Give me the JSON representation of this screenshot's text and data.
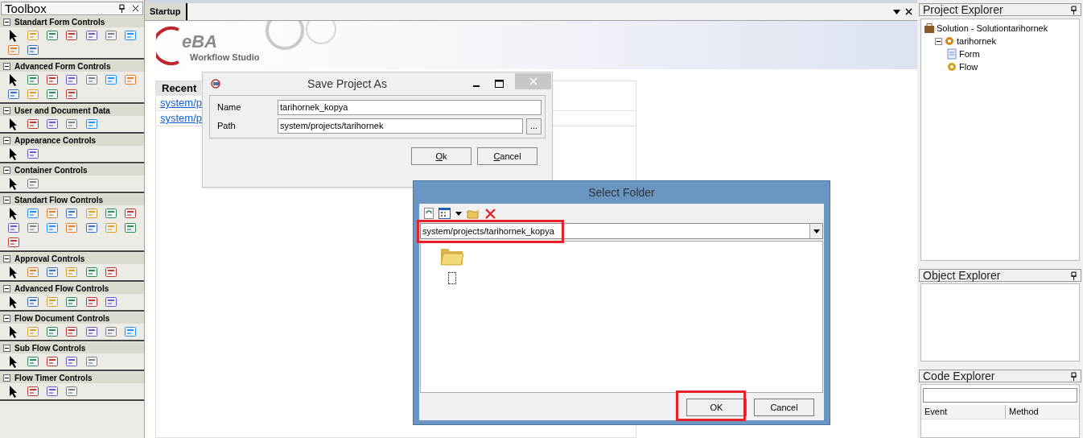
{
  "toolbox": {
    "title": "Toolbox",
    "sections": [
      {
        "title": "Standart Form Controls",
        "expanded": true,
        "tools": [
          {
            "kind": "pointer"
          },
          {
            "kind": "control"
          },
          {
            "kind": "control"
          },
          {
            "kind": "control"
          },
          {
            "kind": "control"
          },
          {
            "kind": "control"
          },
          {
            "kind": "control"
          },
          {
            "kind": "control"
          },
          {
            "kind": "control"
          }
        ]
      },
      {
        "title": "Advanced Form Controls",
        "expanded": true,
        "tools": [
          {
            "kind": "pointer"
          },
          {
            "kind": "control"
          },
          {
            "kind": "control"
          },
          {
            "kind": "control"
          },
          {
            "kind": "control"
          },
          {
            "kind": "control"
          },
          {
            "kind": "control"
          },
          {
            "kind": "control"
          },
          {
            "kind": "control"
          },
          {
            "kind": "control"
          },
          {
            "kind": "control"
          }
        ]
      },
      {
        "title": "User and Document Data",
        "expanded": true,
        "tools": [
          {
            "kind": "pointer"
          },
          {
            "kind": "control"
          },
          {
            "kind": "control"
          },
          {
            "kind": "control"
          },
          {
            "kind": "control"
          }
        ]
      },
      {
        "title": "Appearance Controls",
        "expanded": true,
        "tools": [
          {
            "kind": "pointer"
          },
          {
            "kind": "control"
          }
        ]
      },
      {
        "title": "Container Controls",
        "expanded": true,
        "tools": [
          {
            "kind": "pointer"
          },
          {
            "kind": "control"
          }
        ]
      },
      {
        "title": "Standart Flow Controls",
        "expanded": true,
        "tools": [
          {
            "kind": "pointer"
          },
          {
            "kind": "control"
          },
          {
            "kind": "control"
          },
          {
            "kind": "control"
          },
          {
            "kind": "control"
          },
          {
            "kind": "control"
          },
          {
            "kind": "control"
          },
          {
            "kind": "control"
          },
          {
            "kind": "control"
          },
          {
            "kind": "control"
          },
          {
            "kind": "control"
          },
          {
            "kind": "control"
          },
          {
            "kind": "control"
          },
          {
            "kind": "control"
          },
          {
            "kind": "control"
          }
        ]
      },
      {
        "title": "Approval Controls",
        "expanded": true,
        "tools": [
          {
            "kind": "pointer"
          },
          {
            "kind": "control"
          },
          {
            "kind": "control"
          },
          {
            "kind": "control"
          },
          {
            "kind": "control"
          },
          {
            "kind": "control"
          }
        ]
      },
      {
        "title": "Advanced Flow Controls",
        "expanded": true,
        "tools": [
          {
            "kind": "pointer"
          },
          {
            "kind": "control"
          },
          {
            "kind": "control"
          },
          {
            "kind": "control"
          },
          {
            "kind": "control"
          },
          {
            "kind": "control"
          }
        ]
      },
      {
        "title": "Flow Document Controls",
        "expanded": true,
        "tools": [
          {
            "kind": "pointer"
          },
          {
            "kind": "control"
          },
          {
            "kind": "control"
          },
          {
            "kind": "control"
          },
          {
            "kind": "control"
          },
          {
            "kind": "control"
          },
          {
            "kind": "control"
          }
        ]
      },
      {
        "title": "Sub Flow Controls",
        "expanded": true,
        "tools": [
          {
            "kind": "pointer"
          },
          {
            "kind": "control"
          },
          {
            "kind": "control"
          },
          {
            "kind": "control"
          },
          {
            "kind": "control"
          }
        ]
      },
      {
        "title": "Flow Timer Controls",
        "expanded": true,
        "tools": [
          {
            "kind": "pointer"
          },
          {
            "kind": "control"
          },
          {
            "kind": "control"
          },
          {
            "kind": "control"
          }
        ]
      }
    ]
  },
  "document_tabs": [
    {
      "label": "Startup",
      "selected": true
    }
  ],
  "startup": {
    "logo_mark": "eBA",
    "logo_subtitle": "Workflow Studio",
    "recent": {
      "header": "Recent",
      "links": [
        "system/p",
        "system/p"
      ]
    }
  },
  "save_dialog": {
    "title": "Save Project As",
    "fields": [
      {
        "label": "Name",
        "value": "tarihornek_kopya"
      },
      {
        "label": "Path",
        "value": "system/projects/tarihornek",
        "browse": "..."
      }
    ],
    "buttons": [
      {
        "label": "Ok"
      },
      {
        "label": "Cancel"
      }
    ]
  },
  "select_folder": {
    "title": "Select Folder",
    "path": "system/projects/tarihornek_kopya",
    "path_highlighted": true,
    "items": [
      {
        "kind": "folder"
      },
      {
        "kind": "focus"
      }
    ],
    "buttons": [
      {
        "label": "OK",
        "highlighted": true
      },
      {
        "label": "Cancel",
        "highlighted": false
      }
    ]
  },
  "project_explorer": {
    "title": "Project Explorer",
    "tree": [
      {
        "label": "Solution - Solutiontarihornek",
        "kind": "solution",
        "children": [
          {
            "label": "tarihornek",
            "kind": "project",
            "expanded": true,
            "children": [
              {
                "label": "Form",
                "kind": "form"
              },
              {
                "label": "Flow",
                "kind": "flow"
              }
            ]
          }
        ]
      }
    ]
  },
  "object_explorer": {
    "title": "Object Explorer"
  },
  "code_explorer": {
    "title": "Code Explorer",
    "columns": [
      "Event",
      "Method"
    ]
  }
}
